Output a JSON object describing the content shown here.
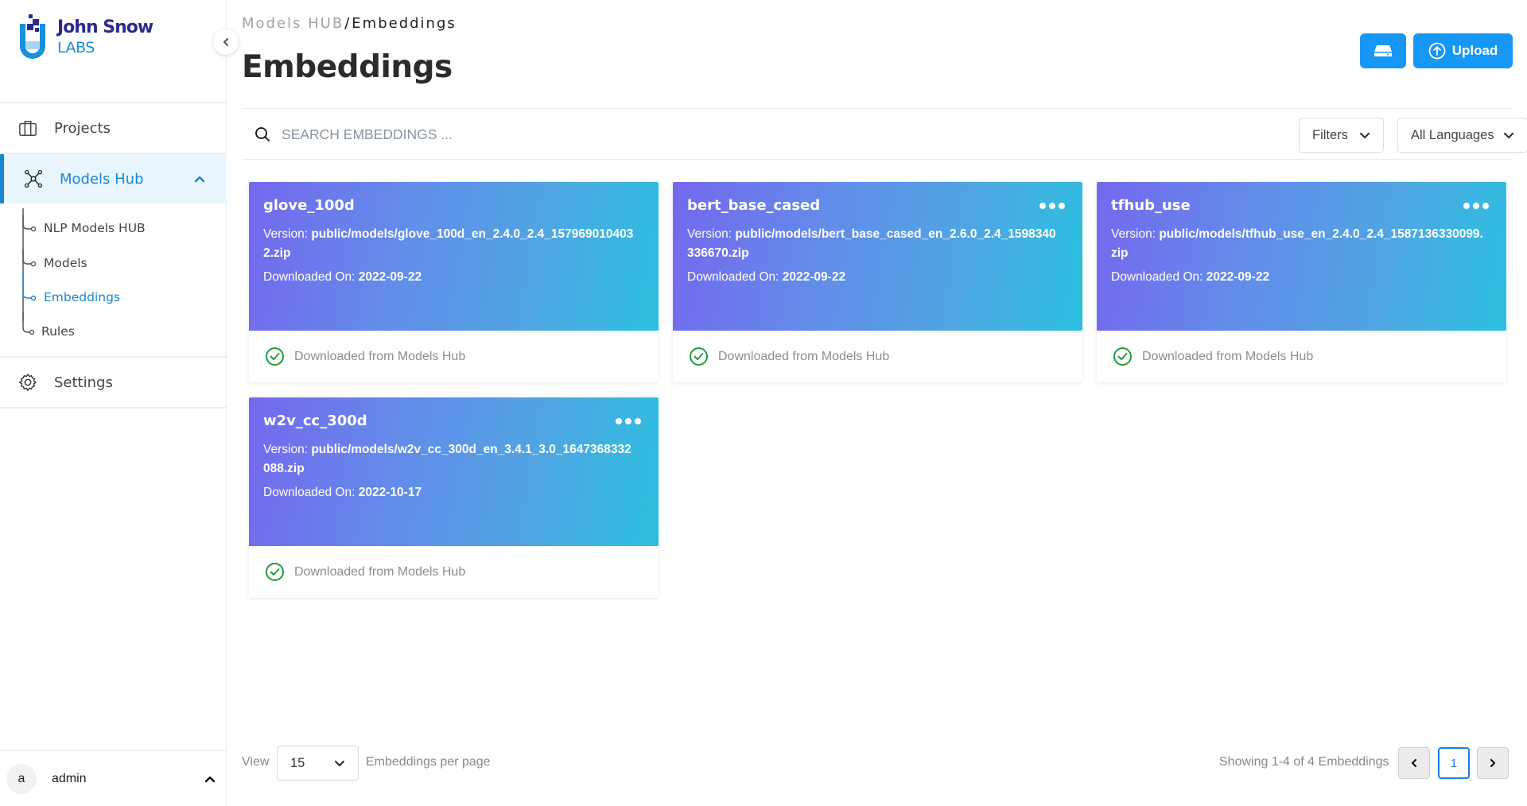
{
  "brand": {
    "line1": "John Snow",
    "line2": "LABS",
    "colors": {
      "primary": "#2d2a8c",
      "accent": "#1a8fdc"
    }
  },
  "sidebar": {
    "items": [
      {
        "label": "Projects",
        "icon": "briefcase-icon"
      },
      {
        "label": "Models Hub",
        "icon": "network-icon",
        "active": true,
        "expanded": true
      },
      {
        "label": "Settings",
        "icon": "gear-icon"
      }
    ],
    "sub_items": [
      {
        "label": "NLP Models HUB"
      },
      {
        "label": "Models"
      },
      {
        "label": "Embeddings",
        "active": true
      },
      {
        "label": "Rules"
      }
    ],
    "user": {
      "avatar_letter": "a",
      "name": "admin"
    }
  },
  "header": {
    "breadcrumb": {
      "parent": "Models HUB",
      "separator": "/",
      "current": "Embeddings"
    },
    "title": "Embeddings",
    "storage_button_icon": "hard-drive-icon",
    "upload_label": "Upload"
  },
  "toolbar": {
    "search_placeholder": "SEARCH EMBEDDINGS ...",
    "search_value": "",
    "filters_label": "Filters",
    "language_label": "All Languages"
  },
  "cards": [
    {
      "name": "glove_100d",
      "version_label": "Version:",
      "version": "public/models/glove_100d_en_2.4.0_2.4_1579690104032.zip",
      "date_label": "Downloaded On:",
      "date": "2022-09-22",
      "status": "Downloaded from Models Hub",
      "has_menu": false
    },
    {
      "name": "bert_base_cased",
      "version_label": "Version:",
      "version": "public/models/bert_base_cased_en_2.6.0_2.4_1598340336670.zip",
      "date_label": "Downloaded On:",
      "date": "2022-09-22",
      "status": "Downloaded from Models Hub",
      "has_menu": true
    },
    {
      "name": "tfhub_use",
      "version_label": "Version:",
      "version": "public/models/tfhub_use_en_2.4.0_2.4_1587136330099.zip",
      "date_label": "Downloaded On:",
      "date": "2022-09-22",
      "status": "Downloaded from Models Hub",
      "has_menu": true
    },
    {
      "name": "w2v_cc_300d",
      "version_label": "Version:",
      "version": "public/models/w2v_cc_300d_en_3.4.1_3.0_1647368332088.zip",
      "date_label": "Downloaded On:",
      "date": "2022-10-17",
      "status": "Downloaded from Models Hub",
      "has_menu": true
    }
  ],
  "pagination": {
    "view_label": "View",
    "per_page": "15",
    "per_page_suffix": "Embeddings per page",
    "showing": "Showing 1-4 of 4 Embeddings",
    "prev_glyph": "‹",
    "current_page": "1",
    "next_glyph": "›"
  },
  "colors": {
    "accent_blue": "#1797f5",
    "active_nav": "#1786d2",
    "success_green": "#1f9d3a",
    "card_gradient_start": "#7468ee",
    "card_gradient_end": "#2bc0e0"
  }
}
